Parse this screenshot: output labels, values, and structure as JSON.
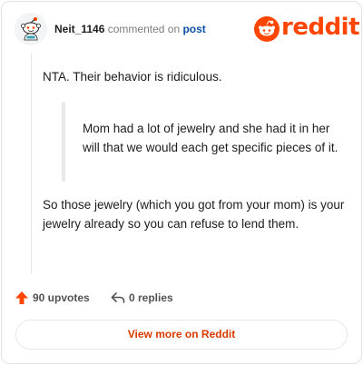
{
  "header": {
    "username": "Neit_1146",
    "commented_on": "commented on",
    "post_link": "post",
    "logo_text": "reddit"
  },
  "comment": {
    "paragraph_1": "NTA. Their behavior is ridiculous.",
    "quote": "Mom had a lot of jewelry and she had it in her will that we would each get specific pieces of it.",
    "paragraph_2": "So those jewelry (which you got from your mom) is your jewelry already so you can refuse to lend them."
  },
  "stats": {
    "upvotes": "90 upvotes",
    "replies": "0 replies"
  },
  "footer": {
    "view_more": "View more on Reddit"
  },
  "colors": {
    "brand": "#ff4500",
    "link": "#0b4fa8",
    "cta": "#d93a00"
  },
  "icons": {
    "avatar": "snoo-avatar-icon",
    "logo": "reddit-snoo-icon",
    "upvote": "upvote-arrow-icon",
    "reply": "reply-arrow-icon"
  }
}
